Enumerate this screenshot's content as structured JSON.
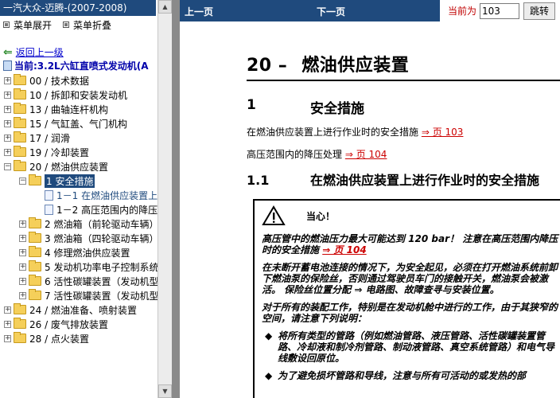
{
  "left": {
    "title": "一汽大众-迈腾-(2007-2008)",
    "menu": {
      "expand": "菜单展开",
      "collapse": "菜单折叠"
    },
    "back": "返回上一级",
    "current": "当前:3.2L六缸直喷式发动机(A",
    "tree": [
      {
        "pm": "+",
        "label": "00 / 技术数据"
      },
      {
        "pm": "+",
        "label": "10 / 拆卸和安装发动机"
      },
      {
        "pm": "+",
        "label": "13 / 曲轴连杆机构"
      },
      {
        "pm": "+",
        "label": "15 / 气缸盖、气门机构"
      },
      {
        "pm": "+",
        "label": "17 / 润滑"
      },
      {
        "pm": "+",
        "label": "19 / 冷却装置"
      },
      {
        "pm": "−",
        "label": "20 / 燃油供应装置"
      },
      {
        "pm": "−",
        "label": "1 安全措施"
      },
      {
        "pm": "",
        "label": "1－1 在燃油供应装置上"
      },
      {
        "pm": "",
        "label": "1－2 高压范围内的降压"
      },
      {
        "pm": "+",
        "label": "2 燃油箱（前轮驱动车辆）"
      },
      {
        "pm": "+",
        "label": "3 燃油箱（四轮驱动车辆）"
      },
      {
        "pm": "+",
        "label": "4 修理燃油供应装置"
      },
      {
        "pm": "+",
        "label": "5 发动机功率电子控制系统"
      },
      {
        "pm": "+",
        "label": "6 活性碳罐装置（发动机型"
      },
      {
        "pm": "+",
        "label": "7 活性碳罐装置（发动机型"
      },
      {
        "pm": "+",
        "label": "24 / 燃油准备、喷射装置"
      },
      {
        "pm": "+",
        "label": "26 / 废气排放装置"
      },
      {
        "pm": "+",
        "label": "28 / 点火装置"
      }
    ]
  },
  "topbar": {
    "prev": "上一页",
    "next": "下一页",
    "current_label": "当前为",
    "page_value": "103",
    "go": "跳转"
  },
  "doc": {
    "h1_num": "20 –",
    "h1_text": "燃油供应装置",
    "h2_num": "1",
    "h2_text": "安全措施",
    "p1_text": "在燃油供应装置上进行作业时的安全措施",
    "p1_ref": "⇒ 页 103",
    "p2_text": "高压范围内的降压处理",
    "p2_ref": "⇒ 页 104",
    "h3_num": "1.1",
    "h3_text": "在燃油供应装置上进行作业时的安全措施",
    "notice": {
      "title": "当心！",
      "para1": "高压管中的燃油压力最大可能达到 120 bar！ 注意在高压范围内降压时的安全措施",
      "para1_ref": "⇒ 页 104",
      "para2": "在未断开蓄电池连接的情况下，为安全起见，必须在打开燃油系统前卸下燃油泵的保险丝，否则通过驾驶员车门的接触开关，燃油泵会被激活。 保险丝位置分配 ⇒ 电路图、故障查寻与安装位置。",
      "para3": "对于所有的装配工作，特别是在发动机舱中进行的工作，由于其狭窄的空间，请注意下列说明：",
      "bullet1": "将所有类型的管路（例如燃油管路、液压管路、活性碳罐装置管路、冷却液和制冷剂管路、制动液管路、真空系统管路）和电气导线敷设回原位。",
      "bullet2": "为了避免损坏管路和导线，注意与所有可活动的或发热的部"
    }
  }
}
